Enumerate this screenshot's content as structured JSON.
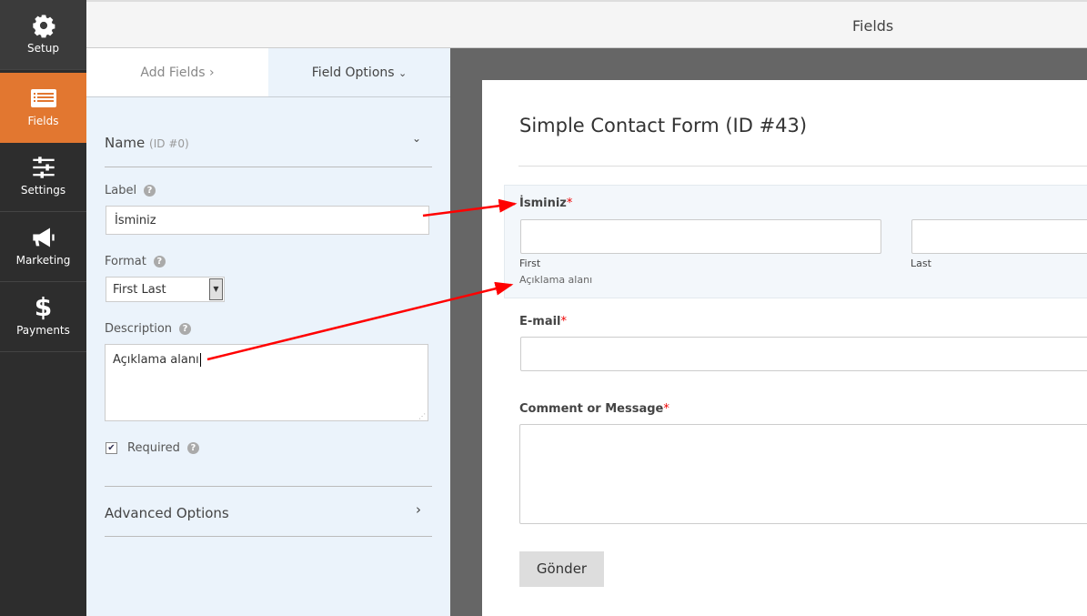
{
  "sidebar": {
    "items": [
      {
        "label": "Setup",
        "icon": "gear-icon"
      },
      {
        "label": "Fields",
        "icon": "list-icon",
        "active": true
      },
      {
        "label": "Settings",
        "icon": "sliders-icon"
      },
      {
        "label": "Marketing",
        "icon": "megaphone-icon"
      },
      {
        "label": "Payments",
        "icon": "dollar-icon"
      }
    ]
  },
  "header": {
    "title": "Fields"
  },
  "tabs": {
    "add_fields": "Add Fields",
    "field_options": "Field Options"
  },
  "options": {
    "section_title": "Name",
    "section_id": "(ID #0)",
    "label_label": "Label",
    "label_value": "İsminiz",
    "format_label": "Format",
    "format_value": "First Last",
    "description_label": "Description",
    "description_value": "Açıklama alanı",
    "required_label": "Required",
    "required_checked": true,
    "advanced": "Advanced Options"
  },
  "form": {
    "title": "Simple Contact Form (ID #43)",
    "name_label": "İsminiz",
    "first": "First",
    "last": "Last",
    "description": "Açıklama alanı",
    "email_label": "E-mail",
    "message_label": "Comment or Message",
    "required_mark": "*",
    "submit": "Gönder"
  },
  "colors": {
    "accent": "#e27730",
    "arrow": "#ff0000",
    "sidebar": "#2d2d2d",
    "panel": "#ebf3fb"
  }
}
